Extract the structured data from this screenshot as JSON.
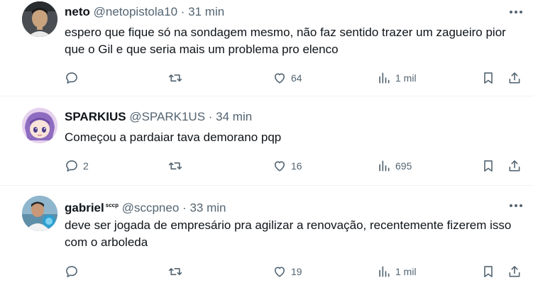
{
  "tweets": [
    {
      "name": "neto",
      "badge": "",
      "handle": "@netopistola10",
      "time": "31 min",
      "text": "espero que fique só na sondagem mesmo, não faz sentido trazer um zagueiro pior que o Gil e que seria mais um problema pro elenco",
      "replies": "",
      "retweets": "",
      "likes": "64",
      "views": "1 mil"
    },
    {
      "name": "SPARKIUS",
      "badge": "",
      "handle": "@SPARK1US",
      "time": "34 min",
      "text": "Começou a pardaiar tava demorano pqp",
      "replies": "2",
      "retweets": "",
      "likes": "16",
      "views": "695"
    },
    {
      "name": "gabriel",
      "badge": "sccp",
      "handle": "@sccpneo",
      "time": "33 min",
      "text": "deve ser jogada de empresário pra agilizar a renovação, recentemente fizerem isso com o arboleda",
      "replies": "",
      "retweets": "",
      "likes": "19",
      "views": "1 mil"
    }
  ],
  "separator": "·",
  "icons": {
    "reply": "reply-icon",
    "retweet": "retweet-icon",
    "like": "heart-icon",
    "views": "views-icon",
    "bookmark": "bookmark-icon",
    "share": "share-icon",
    "more": "more-icon"
  },
  "colors": {
    "text": "#0f1419",
    "secondary": "#536471",
    "border": "#eff3f4"
  }
}
